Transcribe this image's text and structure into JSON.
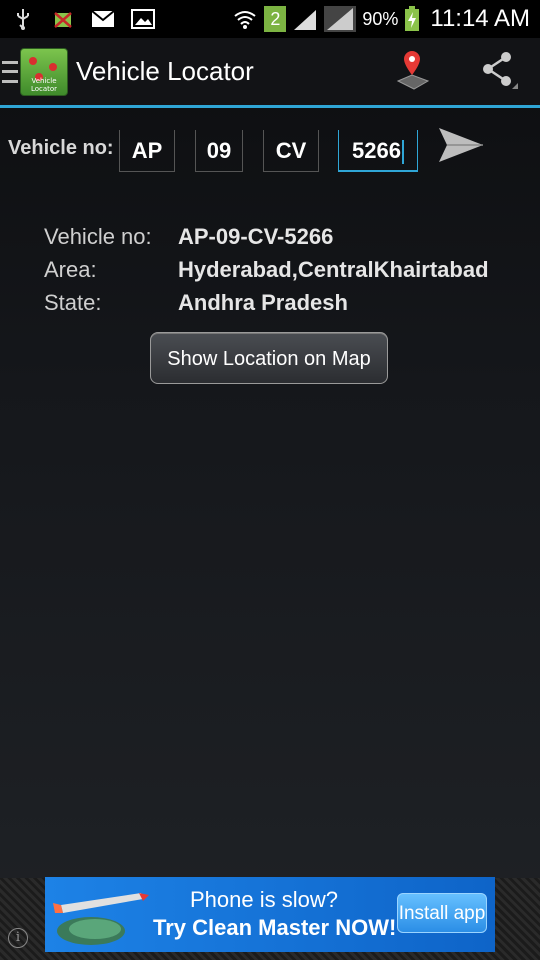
{
  "status_bar": {
    "icons_left": [
      "usb-icon",
      "android-debug-icon",
      "gmail-icon",
      "gallery-icon"
    ],
    "sim_badge": "2",
    "battery_percent": "90%",
    "time": "11:14 AM"
  },
  "app_bar": {
    "title": "Vehicle Locator",
    "icon_caption": "Vehicle Locator",
    "actions": [
      "map-pin-icon",
      "share-icon"
    ]
  },
  "form": {
    "label": "Vehicle no:",
    "segments": [
      "AP",
      "09",
      "CV",
      "5266"
    ],
    "active_segment": 3
  },
  "info": {
    "rows": [
      {
        "key": "Vehicle no:",
        "value": "AP-09-CV-5266"
      },
      {
        "key": "Area:",
        "value": "Hyderabad,CentralKhairtabad"
      },
      {
        "key": "State:",
        "value": "Andhra Pradesh"
      }
    ]
  },
  "map_button": "Show Location on Map",
  "ad": {
    "line1": "Phone is slow?",
    "line2": "Try Clean Master NOW!",
    "cta": "Install app",
    "info_glyph": "i"
  },
  "colors": {
    "accent": "#2fa6d6",
    "ad_blue": "#1d82e6"
  }
}
